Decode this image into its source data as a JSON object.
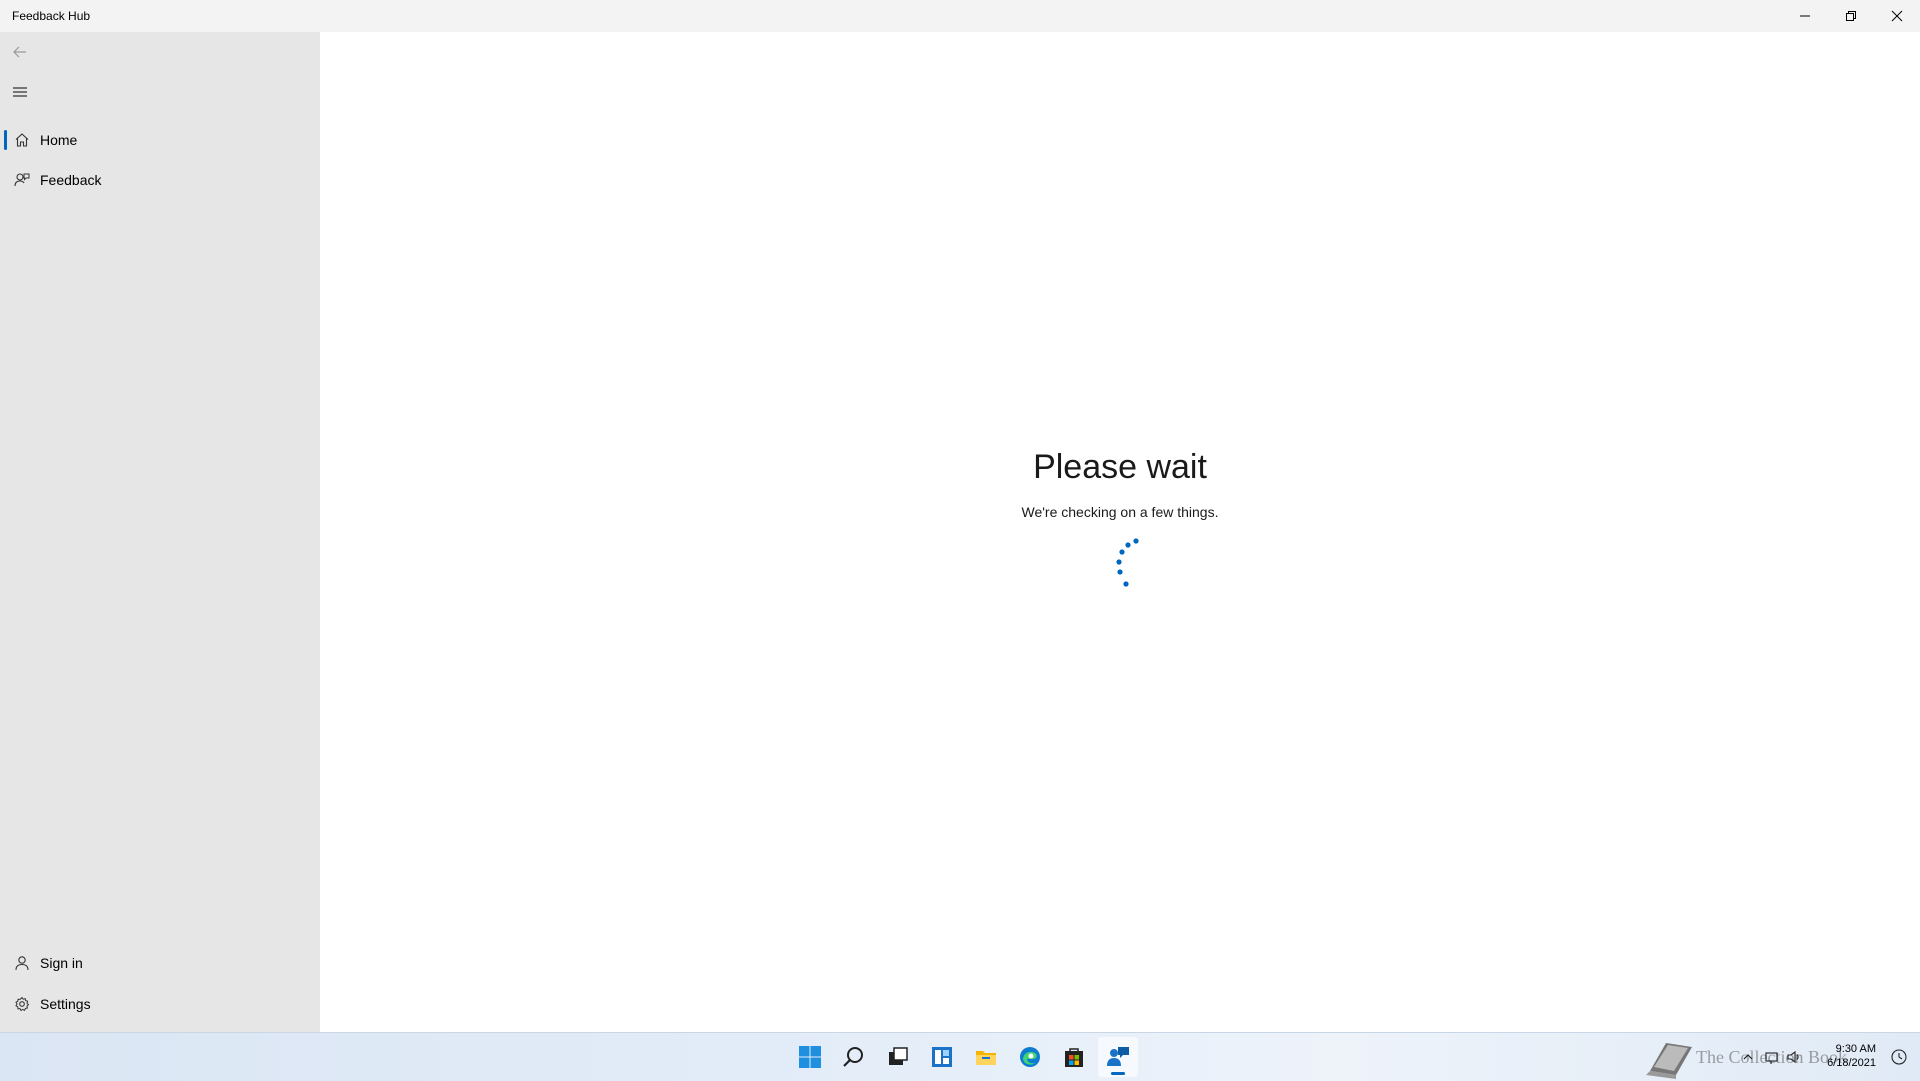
{
  "window": {
    "title": "Feedback Hub"
  },
  "sidebar": {
    "items": [
      {
        "label": "Home",
        "icon": "home-icon",
        "active": true
      },
      {
        "label": "Feedback",
        "icon": "feedback-icon",
        "active": false
      }
    ],
    "bottom_items": [
      {
        "label": "Sign in",
        "icon": "person-icon"
      },
      {
        "label": "Settings",
        "icon": "gear-icon"
      }
    ]
  },
  "main": {
    "title": "Please wait",
    "subtitle": "We're checking on a few things."
  },
  "taskbar": {
    "apps": [
      "start-icon",
      "search-icon",
      "task-view-icon",
      "widgets-icon",
      "file-explorer-icon",
      "edge-icon",
      "store-icon",
      "feedback-hub-icon"
    ],
    "watermark": "The Collection Book",
    "clock_time": "9:30 AM",
    "clock_date": "6/18/2021"
  },
  "colors": {
    "accent": "#0067c0",
    "sidebar_bg": "#e6e6e6",
    "titlebar_bg": "#f3f3f3"
  }
}
